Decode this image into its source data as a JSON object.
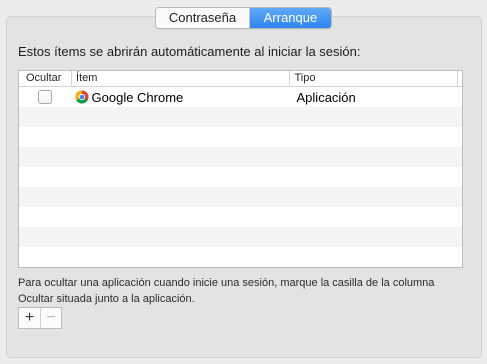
{
  "tabs": {
    "password": "Contraseña",
    "startup": "Arranque"
  },
  "intro_text": "Estos ítems se abrirán automáticamente al iniciar la sesión:",
  "table": {
    "columns": {
      "hide": "Ocultar",
      "item": "Ítem",
      "type": "Tipo"
    },
    "rows": [
      {
        "hidden": false,
        "icon": "chrome-icon",
        "item": "Google Chrome",
        "type": "Aplicación"
      }
    ]
  },
  "help_text": "Para ocultar una aplicación cuando inicie una sesión, marque la casilla de la columna Ocultar situada junto a la aplicación.",
  "buttons": {
    "add": "+",
    "remove": "−"
  },
  "colors": {
    "accent": "#2f84f1",
    "window_bg": "#ececec",
    "panel_bg": "#e3e3e3",
    "row_alt": "#f4f4f4"
  }
}
